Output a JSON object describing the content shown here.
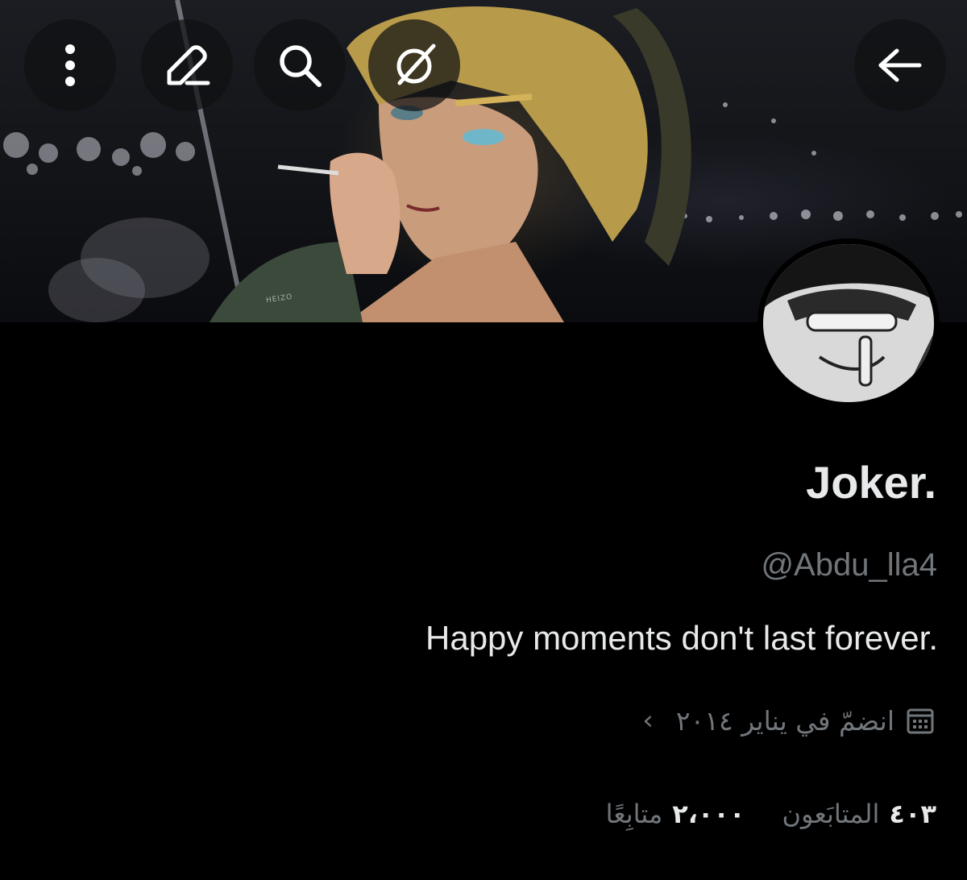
{
  "banner": {
    "watermark": "HEIZO",
    "description_icon": "anime-banner-image"
  },
  "header": {
    "buttons": [
      {
        "name": "more",
        "icon": "more-vertical-icon"
      },
      {
        "name": "edit",
        "icon": "pencil-icon"
      },
      {
        "name": "search",
        "icon": "search-icon"
      },
      {
        "name": "grok",
        "icon": "grok-icon"
      },
      {
        "name": "back",
        "icon": "arrow-right-icon"
      }
    ]
  },
  "profile": {
    "display_name": "Joker.",
    "handle": "@Abdu_lla4",
    "bio": "Happy moments don't last forever.",
    "joined": "انضمّ في يناير ٢٠١٤",
    "joined_chevron": "‹",
    "followers_count": "٤٠٣",
    "followers_label": "المتابَعون",
    "following_count": "٢،٠٠٠",
    "following_label": "متابِعًا"
  },
  "colors": {
    "background": "#000000",
    "text_primary": "#e7e9ea",
    "text_secondary": "#71767b",
    "button_bg": "#0f1012"
  }
}
